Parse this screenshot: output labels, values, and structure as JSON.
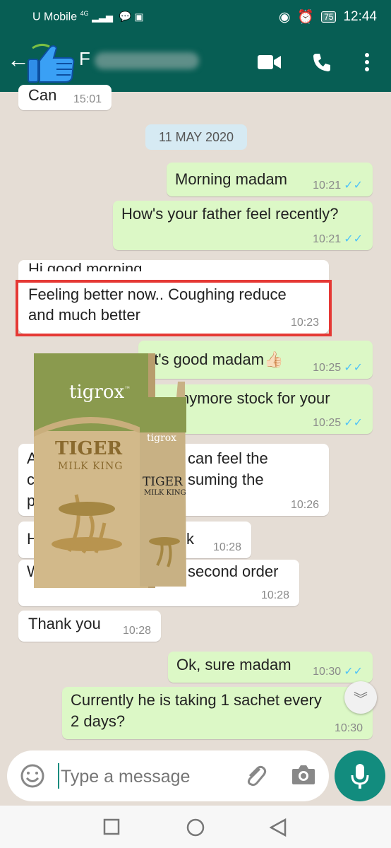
{
  "status_bar": {
    "carrier": "U Mobile",
    "signal_label": "4G",
    "battery": "75",
    "time": "12:44"
  },
  "header": {
    "contact_initial": "F",
    "back_icon": "arrow-left-icon",
    "video_icon": "video-icon",
    "call_icon": "phone-icon",
    "menu_icon": "more-vert-icon"
  },
  "date_separator": "11 MAY 2020",
  "messages": [
    {
      "text": "Can",
      "time": "15:01"
    },
    {
      "text": "Morning madam",
      "time": "10:21"
    },
    {
      "text": "How's your father feel recently?",
      "time": "10:21"
    },
    {
      "line1": "Hi good morning",
      "line2": "Feeling better now.. Coughing reduce",
      "line3": "and much better",
      "time": "10:23"
    },
    {
      "text": "at's good madam",
      "emoji": "👍🏻",
      "time": "10:25"
    },
    {
      "text": "nymore stock for your",
      "time": "10:25"
    },
    {
      "line1": "can feel the",
      "line2": "suming the",
      "time": "10:26",
      "lead1": "A",
      "lead2": "c",
      "lead3": "p"
    },
    {
      "text": "k",
      "lead": "H",
      "time": "10:28"
    },
    {
      "text": "second order",
      "lead": "W",
      "time": "10:28"
    },
    {
      "text": "Thank you",
      "time": "10:28"
    },
    {
      "text": "Ok, sure madam",
      "time": "10:30"
    },
    {
      "line1": "Currently he is taking 1 sachet every",
      "line2": "2 days?",
      "time": "10:30"
    }
  ],
  "product": {
    "brand": "tigrox",
    "tm": "™",
    "name_line1": "TIGER",
    "name_line2": "MILK KING",
    "sachet_brand": "tigrox",
    "sachet_name1": "TIGER",
    "sachet_name2": "MILK KING"
  },
  "input": {
    "placeholder": "Type a message",
    "emoji_icon": "emoji-icon",
    "attach_icon": "paperclip-icon",
    "camera_icon": "camera-icon",
    "mic_icon": "mic-icon"
  },
  "colors": {
    "header": "#075e54",
    "outgoing": "#dcf8c6",
    "incoming": "#ffffff",
    "highlight": "#e53935",
    "accent": "#128c7e"
  }
}
